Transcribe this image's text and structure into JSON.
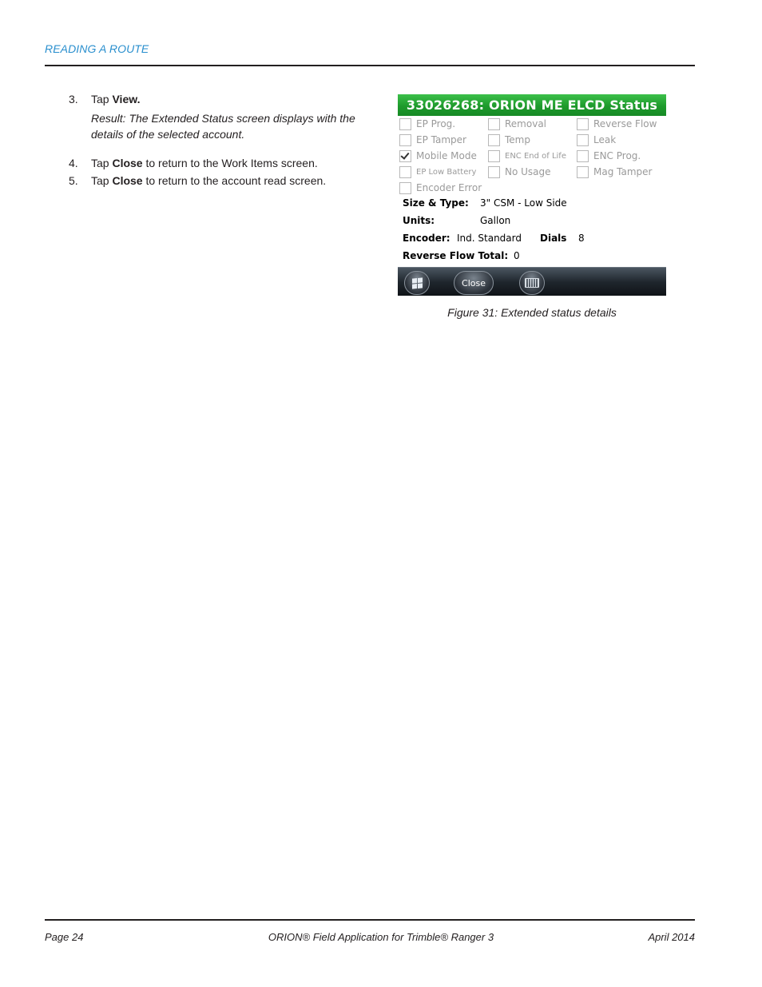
{
  "header": {
    "section": "READING A ROUTE"
  },
  "steps": [
    {
      "num": "3.",
      "prefix": "Tap ",
      "bold": "View.",
      "suffix": ""
    },
    {
      "num": "4.",
      "prefix": "Tap ",
      "bold": "Close",
      "suffix": " to return to the Work Items screen."
    },
    {
      "num": "5.",
      "prefix": "Tap ",
      "bold": "Close",
      "suffix": " to return to the account read screen."
    }
  ],
  "result": "Result: The Extended Status screen displays with the details of the selected account.",
  "device": {
    "title": "33026268: ORION ME ELCD Status",
    "checkboxes": [
      {
        "label": "EP Prog.",
        "checked": false
      },
      {
        "label": "Removal",
        "checked": false
      },
      {
        "label": "Reverse Flow",
        "checked": false
      },
      {
        "label": "EP Tamper",
        "checked": false
      },
      {
        "label": "Temp",
        "checked": false
      },
      {
        "label": "Leak",
        "checked": false
      },
      {
        "label": "Mobile Mode",
        "checked": true
      },
      {
        "label": "ENC End of Life",
        "checked": false
      },
      {
        "label": "ENC Prog.",
        "checked": false
      },
      {
        "label": "EP Low Battery",
        "checked": false
      },
      {
        "label": "No Usage",
        "checked": false
      },
      {
        "label": "Mag Tamper",
        "checked": false
      },
      {
        "label": "Encoder Error",
        "checked": false
      }
    ],
    "size_type_label": "Size & Type:",
    "size_type_value": "3\" CSM - Low Side",
    "units_label": "Units:",
    "units_value": "Gallon",
    "encoder_label": "Encoder:",
    "encoder_value": "Ind. Standard",
    "dials_label": "Dials",
    "dials_value": "8",
    "reverse_flow_label": "Reverse Flow Total:",
    "reverse_flow_value": "0",
    "taskbar": {
      "start_icon": "windows-start-icon",
      "close_label": "Close",
      "keyboard_icon": "keyboard-icon"
    }
  },
  "caption": "Figure 31:  Extended status details",
  "footer": {
    "page": "Page 24",
    "title": "ORION® Field Application for Trimble® Ranger 3",
    "date": "April 2014"
  },
  "colors": {
    "accent_blue": "#2a8fce",
    "title_green": "#1e9a2c"
  }
}
